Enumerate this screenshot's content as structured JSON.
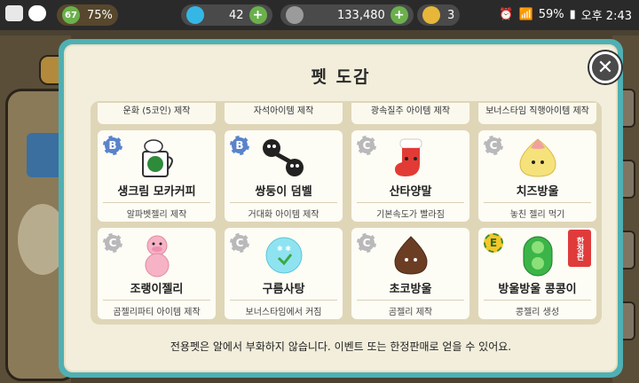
{
  "status_bar": {
    "time": "오후 2:43",
    "battery": "59%"
  },
  "hud": {
    "level": "67",
    "progress": "75%",
    "gems": "42",
    "coins": "133,480",
    "tickets": "3"
  },
  "modal": {
    "title": "펫 도감",
    "close_icon": "close-icon",
    "top_row": [
      "운화 (5코인) 제작",
      "자석아이템 제작",
      "광속질주 아이템 제작",
      "보너스타임 직행아이템 제작"
    ],
    "rows": [
      [
        {
          "grade": "B",
          "name": "생크림 모카커피",
          "desc": "알파벳젤리 제작"
        },
        {
          "grade": "B",
          "name": "쌍둥이 덤벨",
          "desc": "거대화 아이템 제작"
        },
        {
          "grade": "C",
          "name": "산타양말",
          "desc": "기본속도가 빨라짐"
        },
        {
          "grade": "C",
          "name": "치즈방울",
          "desc": "놓친 젤리 먹기"
        }
      ],
      [
        {
          "grade": "C",
          "name": "조랭이젤리",
          "desc": "곰젤리파티 아이템 제작"
        },
        {
          "grade": "C",
          "name": "구름사탕",
          "desc": "보너스타임에서 커짐"
        },
        {
          "grade": "C",
          "name": "초코방울",
          "desc": "곰젤리 제작"
        },
        {
          "grade": "E",
          "name": "방울방울 콩콩이",
          "desc": "콩젤리 생성",
          "limited": "한정판"
        }
      ]
    ],
    "footer": "전용펫은 알에서 부화하지 않습니다. 이벤트 또는 한정판매로 얻을 수 있어요."
  },
  "colors": {
    "modal_frame": "#4fb0b4",
    "modal_bg": "#f2eedb",
    "list_bg": "#dfd6b8"
  }
}
